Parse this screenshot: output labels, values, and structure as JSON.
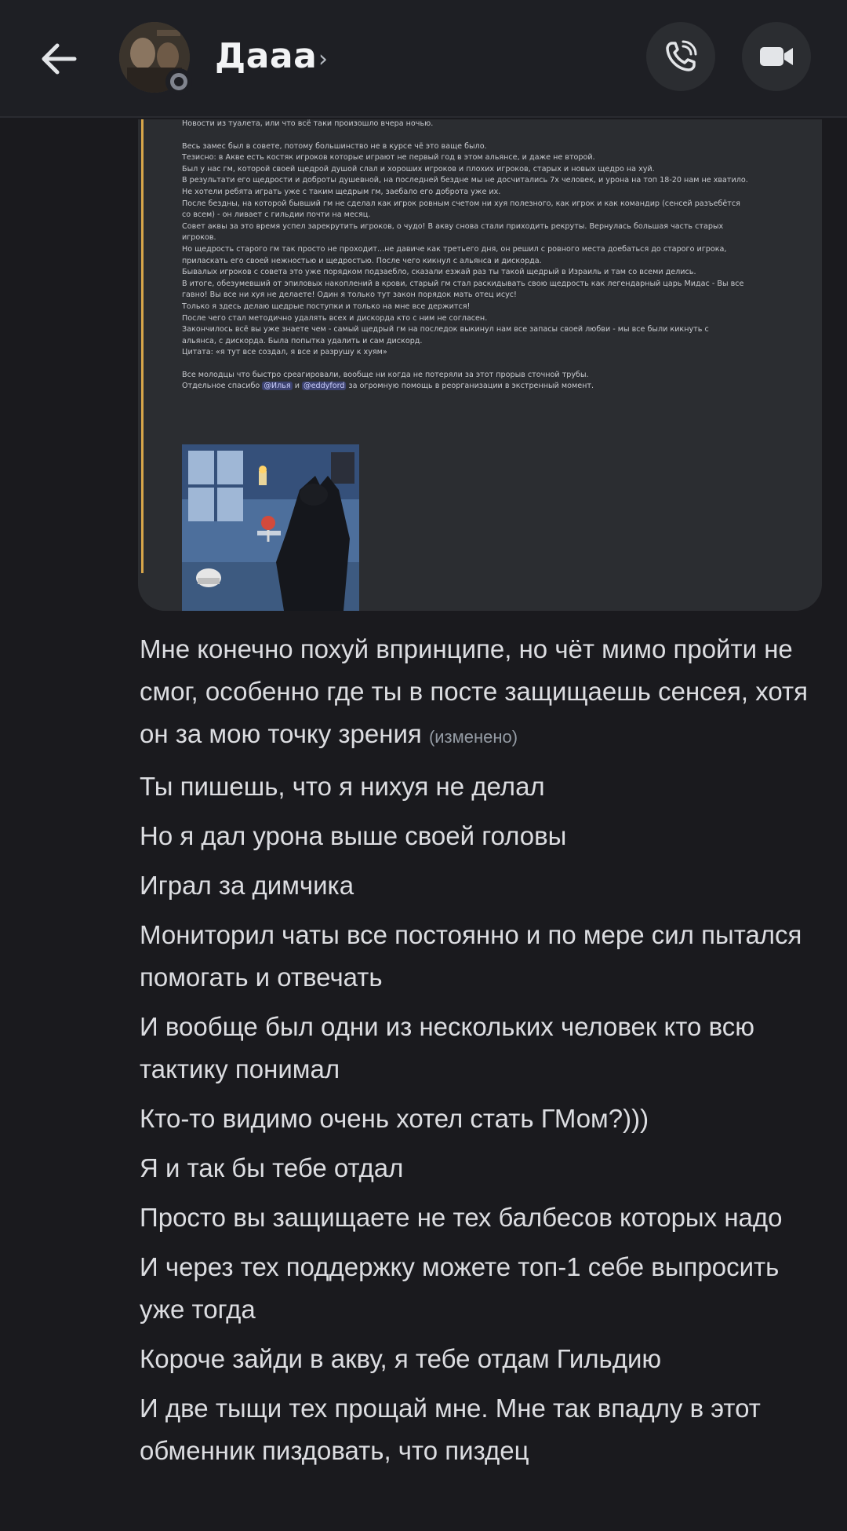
{
  "header": {
    "title": "Дааа",
    "chevron": "›",
    "back_icon": "arrow-left-icon",
    "call_icon": "phone-icon",
    "video_icon": "video-camera-icon"
  },
  "embed": {
    "lines": [
      "Новости из туалета, или что всё таки произошло вчера ночью.",
      "",
      "Весь замес был в совете, потому большинство не в курсе чё это ваще было.",
      "Тезисно: в Акве есть костяк игроков которые играют не первый год в этом альянсе, и даже не второй.",
      "Был у нас гм, которой своей щедрой душой слал и хороших игроков и плохих игроков, старых и новых щедро на хуй.",
      "В результати его щедрости и доброты душевной, на последней бездне мы не досчитались 7х человек, и урона на топ 18-20 нам не хватило.",
      "Не хотели ребята играть уже с таким щедрым гм, заебало его доброта уже их.",
      "После бездны, на которой бывший гм не сделал как игрок ровным счетом ни хуя полезного, как игрок и как командир (сенсей разъебётся",
      "со всем) - он ливает с гильдии почти на месяц.",
      "Совет аквы за это время успел зарекрутить игроков, о чудо! В акву снова стали приходить рекруты. Вернулась большая часть старых",
      "игроков.",
      "Но щедрость старого гм так просто не проходит...не давиче как третьего дня, он решил с ровного места доебаться до старого игрока,",
      "приласкать его своей нежностью и щедростью. После чего кикнул с альянса и дискорда.",
      "Бывалых игроков с совета это уже порядком подзаебло, сказали езжай раз ты такой щедрый в Израиль и там со всеми делись.",
      "В итоге, обезумевший от эпиловых накоплений в крови, старый гм стал раскидывать свою щедрость как легендарный царь Мидас - Вы все",
      "гавно! Вы все ни хуя не делаете! Один я только тут закон порядок мать отец исус!",
      "Только я здесь делаю щедрые поступки и только на мне все держится!",
      "После чего стал методично удалять всех и дискорда кто с ним не согласен.",
      "Закончилось всё вы уже знаете чем - самый щедрый гм на последок выкинул нам все запасы своей любви - мы все были кикнуть с",
      "альянса, с дискорда. Была попытка удалить и сам дискорд.",
      "Цитата: «я тут все создал, я все и разрушу к хуям»",
      "",
      "Все молодцы что быстро среагировали, вообще ни когда не потеряли за этот прорыв сточной трубы."
    ],
    "thanks_prefix": "Отдельное спасибо ",
    "mention_1": "@Илья",
    "thanks_and": " и ",
    "mention_2": "@eddyford",
    "thanks_suffix": " за огромную помощь в реорганизации в экстренный момент."
  },
  "messages": [
    {
      "text": "Мне конечно похуй впринципе, но чёт мимо пройти не смог, особенно где ты в посте защищаешь сенсея, хотя он за мою точку зрения",
      "edited": "(изменено)"
    },
    {
      "text": "Ты пишешь, что я нихуя не делал"
    },
    {
      "text": "Но я дал урона выше своей головы"
    },
    {
      "text": "Играл за димчика"
    },
    {
      "text": "Мониторил чаты все постоянно и по мере сил пытался помогать и отвечать"
    },
    {
      "text": "И вообще был одни из нескольких человек кто всю тактику понимал"
    },
    {
      "text": "Кто-то видимо очень хотел стать ГМом?)))"
    },
    {
      "text": "Я и так бы тебе отдал"
    },
    {
      "text": "Просто вы защищаете не тех балбесов которых надо"
    },
    {
      "text": "И через тех поддержку можете топ-1 себе выпросить уже тогда"
    },
    {
      "text": "Короче зайди в акву, я тебе отдам Гильдию"
    },
    {
      "text": "И две тыщи тех прощай мне. Мне так впадлу в этот обменник пиздовать, что пиздец"
    }
  ],
  "colors": {
    "background": "#1a1a1e",
    "header": "#1e1f24",
    "embed_bg": "#2b2d31",
    "embed_accent": "#d8a64a",
    "text": "#dcdde1",
    "muted": "#949ba4"
  }
}
